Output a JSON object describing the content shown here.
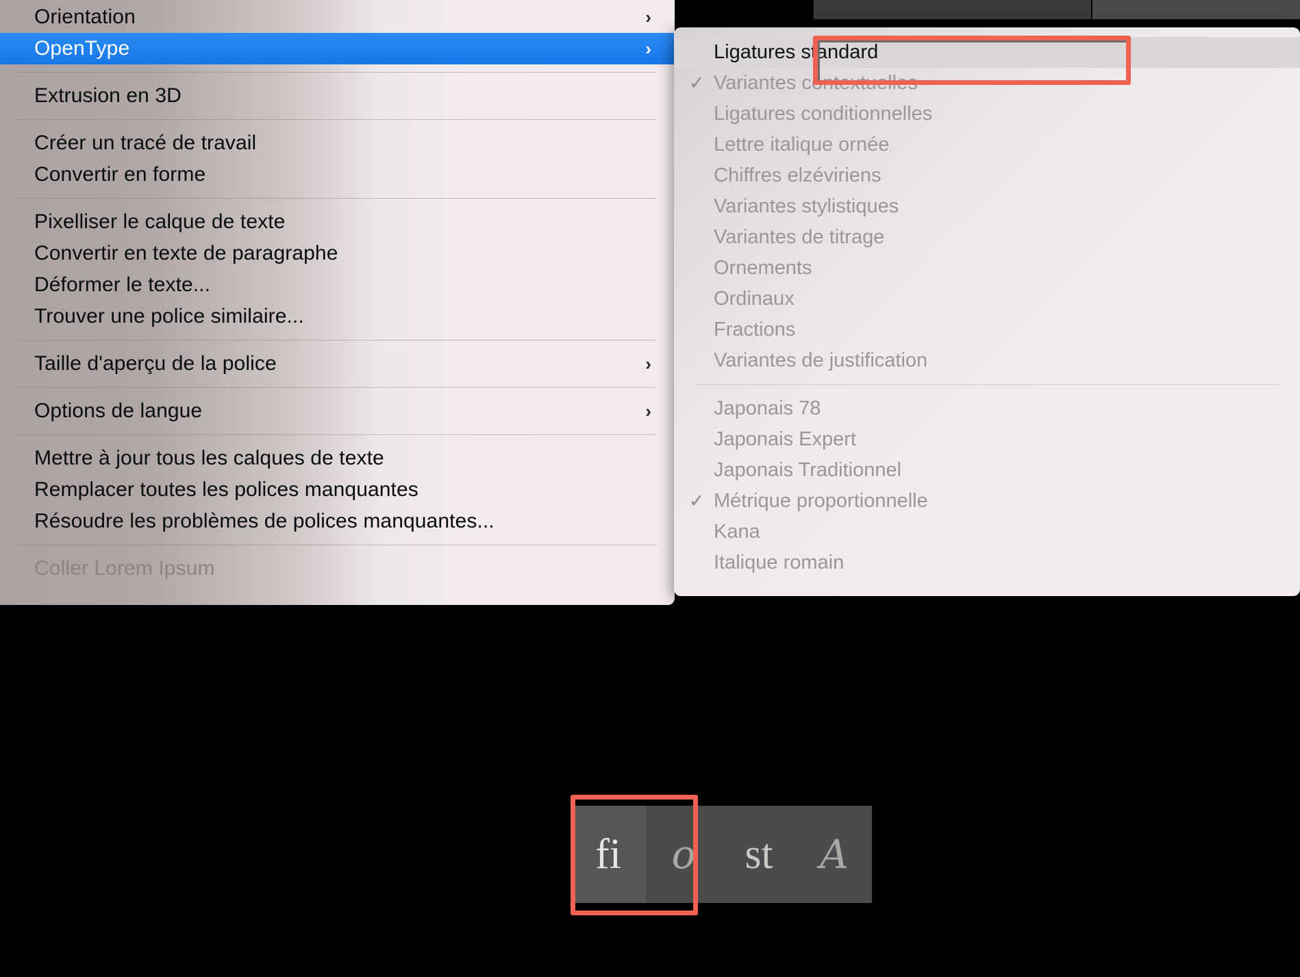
{
  "main_menu": {
    "groups": [
      {
        "items": [
          {
            "label": "Orientation",
            "submenu": true,
            "selected": false,
            "disabled": false
          },
          {
            "label": "OpenType",
            "submenu": true,
            "selected": true,
            "disabled": false
          }
        ]
      },
      {
        "items": [
          {
            "label": "Extrusion en 3D",
            "submenu": false,
            "selected": false,
            "disabled": false
          }
        ]
      },
      {
        "items": [
          {
            "label": "Créer un tracé de travail",
            "submenu": false,
            "selected": false,
            "disabled": false
          },
          {
            "label": "Convertir en forme",
            "submenu": false,
            "selected": false,
            "disabled": false
          }
        ]
      },
      {
        "items": [
          {
            "label": "Pixelliser le calque de texte",
            "submenu": false,
            "selected": false,
            "disabled": false
          },
          {
            "label": "Convertir en texte de paragraphe",
            "submenu": false,
            "selected": false,
            "disabled": false
          },
          {
            "label": "Déformer le texte...",
            "submenu": false,
            "selected": false,
            "disabled": false
          },
          {
            "label": "Trouver une police similaire...",
            "submenu": false,
            "selected": false,
            "disabled": false
          }
        ]
      },
      {
        "items": [
          {
            "label": "Taille d'aperçu de la police",
            "submenu": true,
            "selected": false,
            "disabled": false
          }
        ]
      },
      {
        "items": [
          {
            "label": "Options de langue",
            "submenu": true,
            "selected": false,
            "disabled": false
          }
        ]
      },
      {
        "items": [
          {
            "label": "Mettre à jour tous les calques de texte",
            "submenu": false,
            "selected": false,
            "disabled": false
          },
          {
            "label": "Remplacer toutes les polices manquantes",
            "submenu": false,
            "selected": false,
            "disabled": false
          },
          {
            "label": "Résoudre les problèmes de polices manquantes...",
            "submenu": false,
            "selected": false,
            "disabled": false
          }
        ]
      },
      {
        "items": [
          {
            "label": "Coller Lorem Ipsum",
            "submenu": false,
            "selected": false,
            "disabled": true
          }
        ]
      }
    ]
  },
  "submenu": {
    "title": "OpenType",
    "groups": [
      {
        "items": [
          {
            "label": "Ligatures standard",
            "checked": false,
            "active": true,
            "highlighted": true
          },
          {
            "label": "Variantes contextuelles",
            "checked": true,
            "active": false,
            "highlighted": false
          },
          {
            "label": "Ligatures conditionnelles",
            "checked": false,
            "active": false,
            "highlighted": false
          },
          {
            "label": "Lettre italique ornée",
            "checked": false,
            "active": false,
            "highlighted": false
          },
          {
            "label": "Chiffres elzéviriens",
            "checked": false,
            "active": false,
            "highlighted": false
          },
          {
            "label": "Variantes stylistiques",
            "checked": false,
            "active": false,
            "highlighted": false
          },
          {
            "label": "Variantes de titrage",
            "checked": false,
            "active": false,
            "highlighted": false
          },
          {
            "label": "Ornements",
            "checked": false,
            "active": false,
            "highlighted": false
          },
          {
            "label": "Ordinaux",
            "checked": false,
            "active": false,
            "highlighted": false
          },
          {
            "label": "Fractions",
            "checked": false,
            "active": false,
            "highlighted": false
          },
          {
            "label": "Variantes de justification",
            "checked": false,
            "active": false,
            "highlighted": false
          }
        ]
      },
      {
        "items": [
          {
            "label": "Japonais 78",
            "checked": false,
            "active": false,
            "highlighted": false
          },
          {
            "label": "Japonais Expert",
            "checked": false,
            "active": false,
            "highlighted": false
          },
          {
            "label": "Japonais Traditionnel",
            "checked": false,
            "active": false,
            "highlighted": false
          },
          {
            "label": "Métrique proportionnelle",
            "checked": true,
            "active": false,
            "highlighted": false
          },
          {
            "label": "Kana",
            "checked": false,
            "active": false,
            "highlighted": false
          },
          {
            "label": "Italique romain",
            "checked": false,
            "active": false,
            "highlighted": false
          }
        ]
      }
    ]
  },
  "glyph_toolbar": {
    "buttons": [
      {
        "glyph": "fi",
        "name": "standard-ligature",
        "selected": true,
        "script": false
      },
      {
        "glyph": "o",
        "name": "swash-variant",
        "selected": false,
        "script": true
      },
      {
        "glyph": "st",
        "name": "discretionary-ligature",
        "selected": false,
        "script": false
      },
      {
        "glyph": "A",
        "name": "titling-variant",
        "selected": false,
        "script": true
      }
    ]
  },
  "icons": {
    "submenu_chevron": "›",
    "checkmark": "✓"
  },
  "colors": {
    "accent_selected": "#2a8bf6",
    "annotation_red": "#ef6153",
    "menu_text": "#0b0b0b",
    "disabled_text": "#9c9797",
    "toolbar_bg": "#4b4b4b"
  }
}
